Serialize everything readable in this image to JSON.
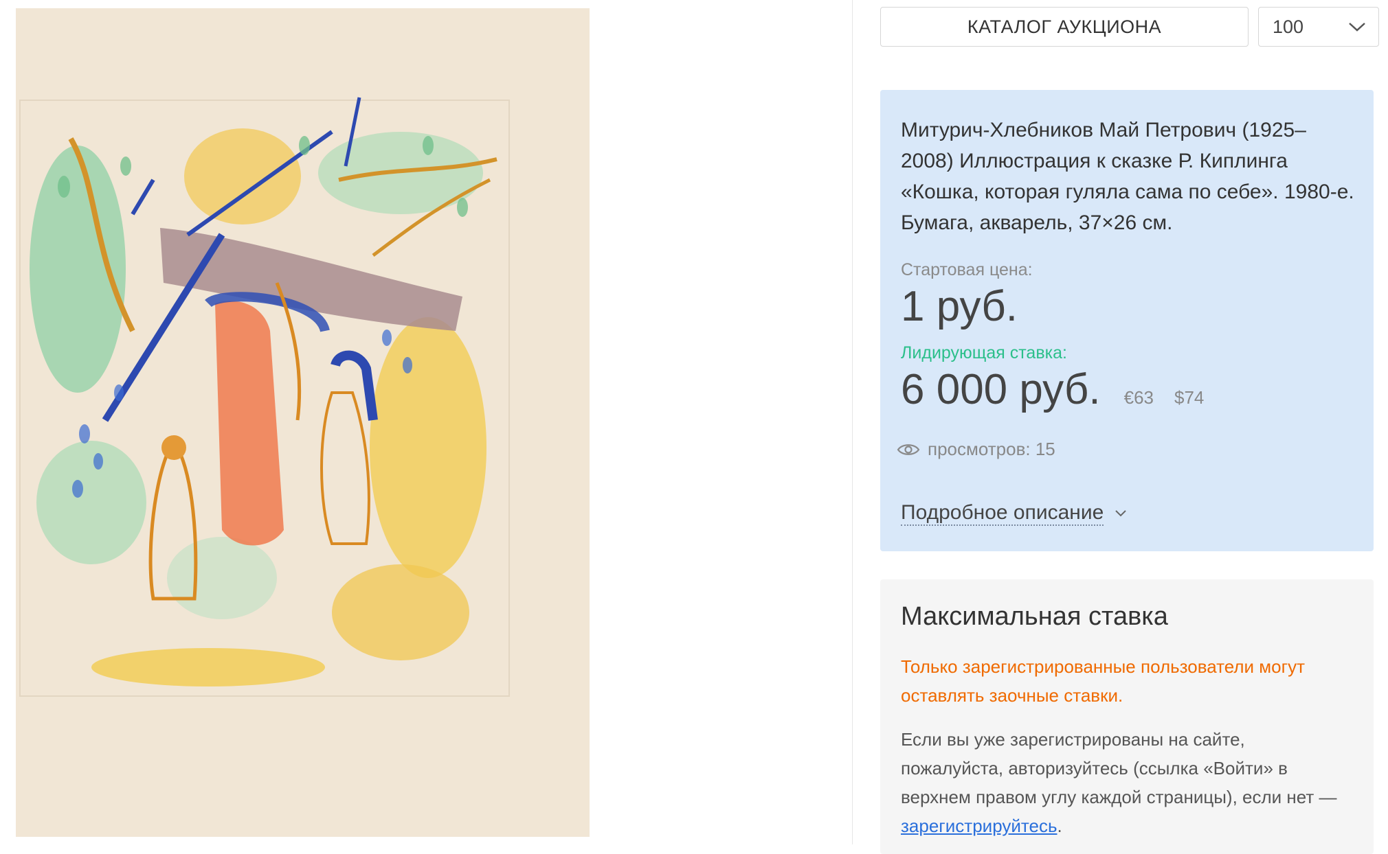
{
  "artwork": {
    "alt_subject": "watercolor-illustration"
  },
  "toolbar": {
    "catalog_label": "КАТАЛОГ АУКЦИОНА",
    "lot_number": "100"
  },
  "lot": {
    "title": "Митурич-Хлебников Май Петрович (1925–2008) Иллюстрация к сказке Р. Киплинга «Кошка, которая гуляла сама по себе». 1980-е. Бумага, акварель, 37×26 см.",
    "start_label": "Стартовая цена:",
    "start_price": "1 руб.",
    "lead_label": "Лидирующая ставка:",
    "lead_price": "6 000 руб.",
    "lead_eur": "€63",
    "lead_usd": "$74",
    "views": "просмотров: 15",
    "details_label": "Подробное описание"
  },
  "maxbid": {
    "title": "Максимальная ставка",
    "warning": "Только зарегистрированные пользователи могут оставлять заочные ставки.",
    "info_prefix": "Если вы уже зарегистрированы на сайте, пожалуйста, авторизуйтесь (ссылка «Войти» в верхнем правом углу каждой страницы), если нет — ",
    "register_link": "зарегистрируйтесь",
    "info_suffix": "."
  },
  "colors": {
    "lot_card_bg": "#d9e8f9",
    "lead_label": "#2bbf8a",
    "warning": "#ef6a00",
    "link": "#2a6fdb"
  }
}
